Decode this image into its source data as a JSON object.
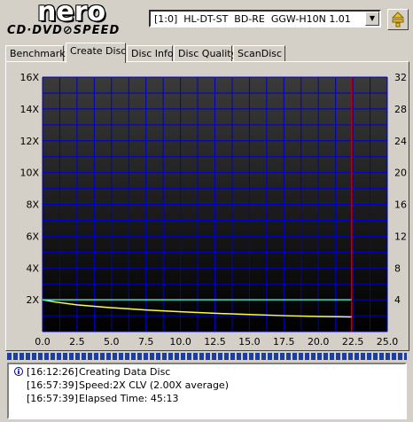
{
  "logo": {
    "brand": "nero",
    "product": "CD·DVD⊘SPEED"
  },
  "drive": {
    "selected": "[1:0]  HL-DT-ST  BD-RE  GGW-H10N 1.01"
  },
  "tabs": [
    {
      "label": "Benchmark",
      "active": false
    },
    {
      "label": "Create Disc",
      "active": true
    },
    {
      "label": "Disc Info",
      "active": false
    },
    {
      "label": "Disc Quality",
      "active": false
    },
    {
      "label": "ScanDisc",
      "active": false
    }
  ],
  "chart_data": {
    "type": "line",
    "left_axis": {
      "range": [
        0,
        16
      ],
      "ticks": [
        "2X",
        "4X",
        "6X",
        "8X",
        "10X",
        "12X",
        "14X",
        "16X"
      ]
    },
    "right_axis": {
      "range": [
        0,
        32
      ],
      "ticks": [
        "4",
        "8",
        "12",
        "16",
        "20",
        "24",
        "28",
        "32"
      ]
    },
    "x_axis": {
      "range": [
        0,
        25
      ],
      "ticks": [
        "0.0",
        "2.5",
        "5.0",
        "7.5",
        "10.0",
        "12.5",
        "15.0",
        "17.5",
        "20.0",
        "22.5",
        "25.0"
      ]
    },
    "grid": true,
    "colors": {
      "background_top": "#3a3a3a",
      "background_bottom": "#000000",
      "grid": "#0000c8",
      "speed": "#ffff40",
      "rpm": "#40e0c0",
      "marker": "#c00000"
    },
    "series": [
      {
        "color": "#ffff40",
        "x": [
          0,
          1,
          2.5,
          5,
          7.5,
          10,
          12.5,
          15,
          17.5,
          20,
          22.4
        ],
        "y": [
          2.0,
          1.85,
          1.68,
          1.5,
          1.36,
          1.25,
          1.15,
          1.07,
          1.0,
          0.95,
          0.92
        ]
      },
      {
        "color": "#40e0c0",
        "x": [
          0,
          22.4
        ],
        "y": [
          2.0,
          2.0
        ]
      }
    ],
    "marker_x": 22.4
  },
  "log": [
    {
      "time": "[16:12:26]",
      "message": "Creating Data Disc"
    },
    {
      "time": "[16:57:39]",
      "message": "Speed:2X CLV (2.00X average)"
    },
    {
      "time": "[16:57:39]",
      "message": "Elapsed Time: 45:13"
    }
  ]
}
